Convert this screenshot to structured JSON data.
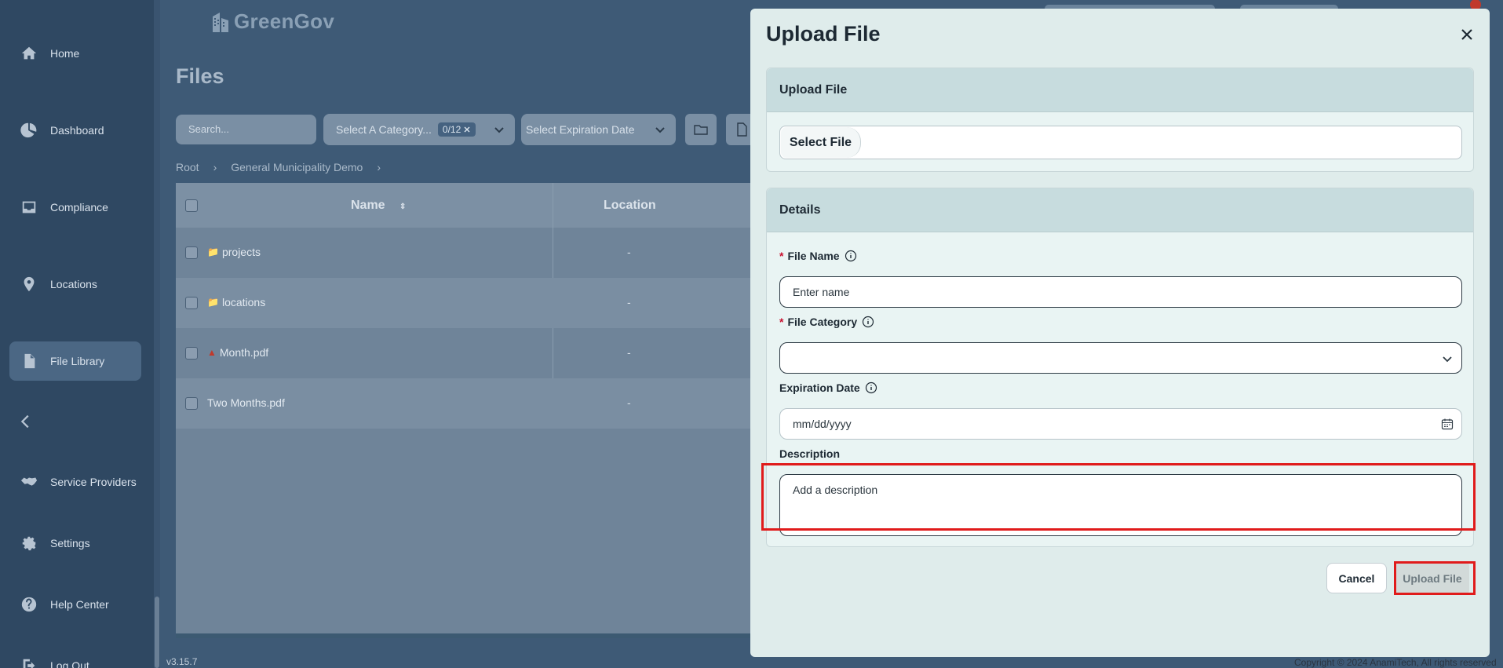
{
  "app": {
    "brand": "GreenGov",
    "version": "v3.15.7",
    "copyright": "Copyright © 2024 AnamiTech, All rights reserved"
  },
  "sidebar": {
    "items": [
      {
        "label": "Home",
        "icon": "home-icon"
      },
      {
        "label": "Dashboard",
        "icon": "pie-chart-icon"
      },
      {
        "label": "Compliance",
        "icon": "inbox-icon"
      },
      {
        "label": "Locations",
        "icon": "map-pin-icon"
      },
      {
        "label": "File Library",
        "icon": "file-icon",
        "active": true
      },
      {
        "label": "Service Providers",
        "icon": "handshake-icon"
      },
      {
        "label": "Settings",
        "icon": "gear-icon"
      },
      {
        "label": "Help Center",
        "icon": "help-icon"
      },
      {
        "label": "Log Out",
        "icon": "logout-icon"
      }
    ],
    "collapse_icon": "chevron-left-icon"
  },
  "page": {
    "title": "Files",
    "search_placeholder": "Search...",
    "category_select": {
      "placeholder": "Select A Category...",
      "badge": "0/12"
    },
    "expiration_select": {
      "placeholder": "Select Expiration Date"
    },
    "breadcrumb": [
      "Root",
      "General Municipality Demo"
    ]
  },
  "table": {
    "columns": [
      "Name",
      "Location"
    ],
    "rows": [
      {
        "name": "projects",
        "type": "folder",
        "location": "-"
      },
      {
        "name": "locations",
        "type": "folder",
        "location": "-"
      },
      {
        "name": "Month.pdf",
        "type": "warning-file",
        "location": "-"
      },
      {
        "name": "Two Months.pdf",
        "type": "file",
        "location": "-"
      }
    ]
  },
  "modal": {
    "title": "Upload File",
    "upload_section": {
      "heading": "Upload File",
      "select_button": "Select File"
    },
    "details_section": {
      "heading": "Details",
      "file_name": {
        "label": "File Name",
        "placeholder": "Enter name",
        "required": true
      },
      "file_category": {
        "label": "File Category",
        "value": "",
        "required": true
      },
      "expiration_date": {
        "label": "Expiration Date",
        "placeholder": "mm/dd/yyyy"
      },
      "description": {
        "label": "Description",
        "placeholder": "Add a description"
      }
    },
    "buttons": {
      "cancel": "Cancel",
      "upload": "Upload File"
    }
  },
  "colors": {
    "highlight": "#e01b1b",
    "required": "#c8102e"
  }
}
